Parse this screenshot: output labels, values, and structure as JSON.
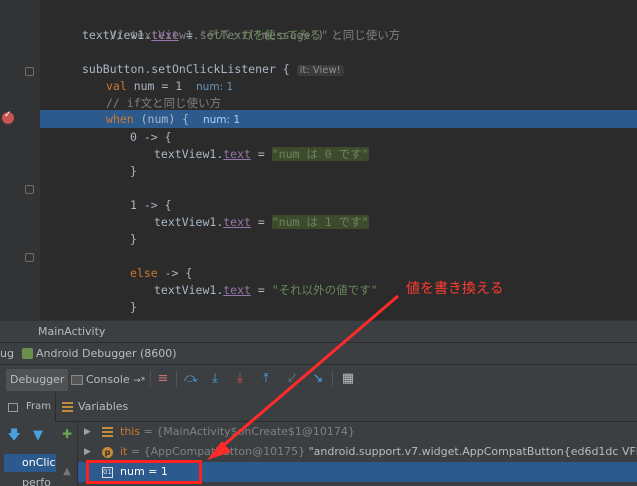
{
  "editor": {
    "lines": [
      {
        "type": "comment",
        "text": "// textView1.setText(\"message\") と同じ使い方"
      },
      {
        "type": "assign",
        "target": "textView1",
        "prop": "text",
        "value": "\"デバッガを使ってみる\""
      },
      {
        "type": "listener",
        "code": "subButton.setOnClickListener {",
        "hint": "it: View!"
      },
      {
        "kw": "val",
        "code": " num = 1",
        "dbg": "num: 1"
      },
      {
        "type": "comment",
        "text": "// if文と同じ使い方"
      },
      {
        "kw": "when",
        "code": " (num) {",
        "dbg": "num: 1"
      },
      {
        "code": "0 -> {"
      },
      {
        "target": "textView1",
        "prop": "text",
        "value": "\"num は 0 です\""
      },
      {
        "code": "}"
      },
      {
        "code": "1 -> {"
      },
      {
        "target": "textView1",
        "prop": "text",
        "value": "\"num は 1 です\""
      },
      {
        "code": "}"
      },
      {
        "kw": "else",
        "code": " -> {"
      },
      {
        "target": "textView1",
        "prop": "text",
        "value": "\"それ以外の値です\""
      },
      {
        "code": "}"
      }
    ]
  },
  "annotation": "値を書き換える",
  "breadcrumb": "MainActivity",
  "debug_header": {
    "prefix": "ug",
    "title": "Android Debugger (8600)"
  },
  "toolbar": {
    "debugger_tab": "Debugger",
    "console_tab": "Console",
    "console_suffix": "→*"
  },
  "frames": {
    "header": "Fram",
    "items": [
      "onClic",
      "perfo"
    ]
  },
  "variables": {
    "header": "Variables",
    "rows": [
      {
        "name": "this",
        "value": "= {MainActivity$onCreate$1@10174}"
      },
      {
        "name": "it",
        "value": "= {AppCompatButton@10175}",
        "str": "\"android.support.v7.widget.AppCompatButton{ed6d1dc VFED..C..."
      },
      {
        "text": "num = 1"
      }
    ]
  }
}
